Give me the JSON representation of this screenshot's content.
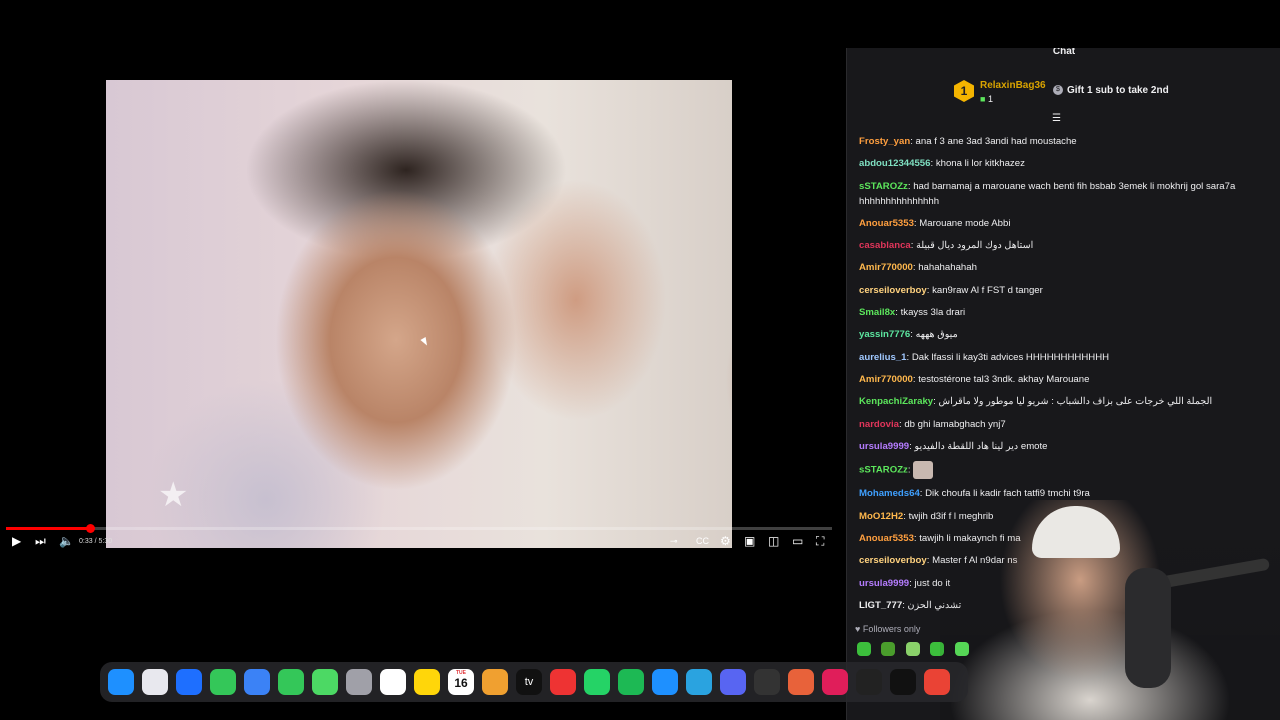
{
  "video": {
    "time": "0:33 / 5:30",
    "progress": 0.105,
    "logo_icon": "star-logo-icon"
  },
  "chat": {
    "header_title": "Chat",
    "top_gifter": {
      "rank": "1",
      "name": "RelaxinBag36",
      "count": "1"
    },
    "gift_prompt": "Gift 1 sub to take 2nd",
    "messages": [
      {
        "user": "Frosty_yan",
        "color": "#ff9f3f",
        "text": "ana f 3 ane 3ad 3andi had moustache"
      },
      {
        "user": "abdou12344556",
        "color": "#7fe0c2",
        "text": "khona li lor kitkhazez"
      },
      {
        "user": "sSTAROZz",
        "color": "#5ce65c",
        "text": "had barnamaj a marouane wach benti fih bsbab 3emek li mokhrij gol sara7a hhhhhhhhhhhhhhh"
      },
      {
        "user": "Anouar5353",
        "color": "#ff9f3f",
        "text": "Marouane mode Abbi"
      },
      {
        "user": "casablanca",
        "color": "#e0355a",
        "text": "استاهل دوك المرود ديال قبيلة"
      },
      {
        "user": "Amir770000",
        "color": "#ffb84d",
        "text": "hahahahahah"
      },
      {
        "user": "cerseiloverboy",
        "color": "#ffd27f",
        "text": "kan9raw Al f FST d tanger"
      },
      {
        "user": "Smail8x",
        "color": "#5ce65c",
        "text": "tkayss 3la drari"
      },
      {
        "user": "yassin7776",
        "color": "#5ce6a0",
        "text": "ميوق هههه"
      },
      {
        "user": "aurelius_1",
        "color": "#a0c8ff",
        "text": "Dak lfassi li kay3ti advices HHHHHHHHHHHH"
      },
      {
        "user": "Amir770000",
        "color": "#ffb84d",
        "text": "testostérone tal3 3ndk. akhay Marouane"
      },
      {
        "user": "KenpachiZaraky",
        "color": "#5ce65c",
        "text": "الجملة اللي خرجات على بزاف دالشباب : شريو ليا موطور ولا ماقراش"
      },
      {
        "user": "nardovia",
        "color": "#e0355a",
        "text": "db ghi lamabghach ynj7"
      },
      {
        "user": "ursula9999",
        "color": "#b57cff",
        "text": "دير لينا هاد اللقطة دالفيديو emote"
      },
      {
        "user": "sSTAROZz",
        "color": "#5ce65c",
        "text": "",
        "emote": "cat-emote-icon"
      },
      {
        "user": "Mohameds64",
        "color": "#3fa0ff",
        "text": "Dik choufa li kadir fach tatfi9 tmchi t9ra"
      },
      {
        "user": "MoO12H2",
        "color": "#ffb84d",
        "text": "twjih d3if f l meghrib"
      },
      {
        "user": "Anouar5353",
        "color": "#ff9f3f",
        "text": "tawjih li makaynch fi ma"
      },
      {
        "user": "cerseiloverboy",
        "color": "#ffd27f",
        "text": "Master f Al n9dar ns"
      },
      {
        "user": "ursula9999",
        "color": "#b57cff",
        "text": "just do it"
      },
      {
        "user": "LIGT_777",
        "color": "#efeff1",
        "text": "تشدني الحزن"
      }
    ],
    "followers_only": "Followers only"
  },
  "dock": {
    "calendar_month": "TUE",
    "calendar_day": "16",
    "apps": [
      "finder-icon",
      "launchpad-icon",
      "safari-icon",
      "messages-icon",
      "mail-icon",
      "facetime-icon",
      "maps-icon",
      "contacts-icon",
      "reminders-icon",
      "notes-icon",
      "calendar-icon",
      "photos-icon",
      "apple-tv-icon",
      "app-icon",
      "whatsapp-icon",
      "spotify-icon",
      "app-store-icon",
      "telegram-icon",
      "discord-icon",
      "script-editor-icon",
      "app2-icon",
      "slack-icon",
      "terminal-icon",
      "cursor-app-icon",
      "chrome-icon"
    ],
    "tv_label": "tv"
  }
}
